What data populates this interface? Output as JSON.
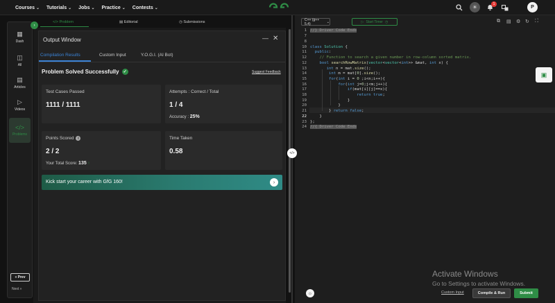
{
  "nav": {
    "items": [
      "Courses",
      "Tutorials",
      "Jobs",
      "Practice",
      "Contests"
    ],
    "notification_count": "1",
    "avatar_letter": "P"
  },
  "sidebar": {
    "items": [
      {
        "label": "Dash",
        "icon": "dashboard-icon"
      },
      {
        "label": "All",
        "icon": "grid-icon"
      },
      {
        "label": "Articles",
        "icon": "book-icon"
      },
      {
        "label": "Videos",
        "icon": "video-icon"
      },
      {
        "label": "Problems",
        "icon": "code-icon"
      }
    ],
    "prev_label": "« Prev",
    "next_label": "Next »"
  },
  "problem_tabs": {
    "problem": "</> Problem",
    "editorial": "Editorial",
    "submissions": "Submissions"
  },
  "output_window": {
    "title": "Output Window",
    "tabs": [
      "Compilation Results",
      "Custom Input",
      "Y.O.G.I. (AI Bot)"
    ],
    "status": "Problem Solved Successfully",
    "feedback": "Suggest Feedback",
    "cards": {
      "test_cases": {
        "label": "Test Cases Passed",
        "value": "1111 / 1111"
      },
      "attempts": {
        "label": "Attempts : Correct / Total",
        "value": "1 / 4",
        "sub_label": "Accuracy :",
        "sub_value": "25%"
      },
      "points": {
        "label": "Points Scored",
        "value": "2 / 2",
        "sub_label": "Your Total Score:",
        "sub_value": "135"
      },
      "time": {
        "label": "Time Taken",
        "value": "0.58"
      }
    },
    "promo": "Kick start your career with GfG 160!"
  },
  "editor": {
    "language": "C++ (g++ 5.4)",
    "timer_label": "Start Timer",
    "current_line": 22
  },
  "footer": {
    "custom_input": "Custom Input",
    "compile_run": "Compile & Run",
    "submit": "Submit"
  },
  "watermark": {
    "line1": "Activate Windows",
    "line2": "Go to Settings to activate Windows."
  },
  "colors": {
    "brand_green": "#2f8d46",
    "tab_blue": "#3b83d6",
    "bg_dark": "#121212"
  }
}
